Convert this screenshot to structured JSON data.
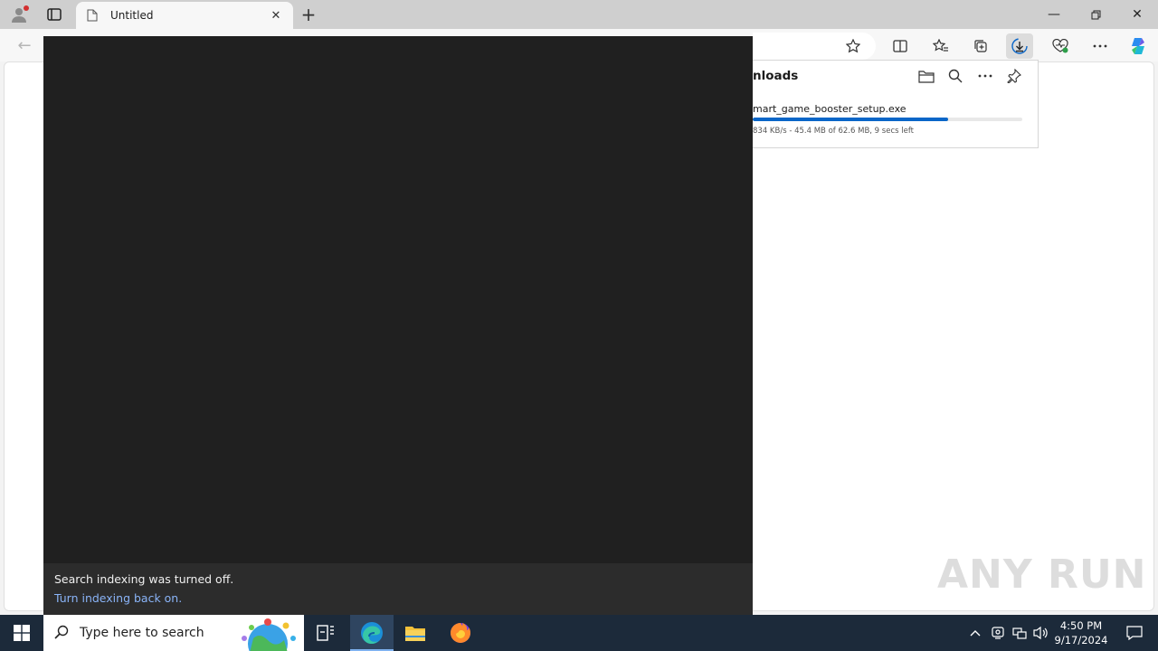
{
  "browser": {
    "tab": {
      "title": "Untitled"
    },
    "new_tab_label": "+"
  },
  "downloads": {
    "title": "nloads",
    "file_name": "mart_game_booster_setup.exe",
    "status": "834 KB/s - 45.4 MB of 62.6 MB, 9 secs left",
    "progress_fraction": 0.725
  },
  "search_panel": {
    "notice": "Search indexing was turned off.",
    "link": "Turn indexing back on."
  },
  "watermark": {
    "text": "ANY RUN"
  },
  "taskbar": {
    "search_placeholder": "Type here to search",
    "time": "4:50 PM",
    "date": "9/17/2024"
  },
  "colors": {
    "accent": "#0a66c8",
    "panel_bg": "#202020",
    "notice_bg": "#2c2c2c",
    "link": "#8ab4f8",
    "taskbar": "#1c2a3a"
  },
  "icons": [
    "profile-icon",
    "tab-actions-icon",
    "page-icon",
    "close-icon",
    "minimize-icon",
    "restore-icon",
    "back-icon",
    "favorite-star-icon",
    "split-screen-icon",
    "favorites-icon",
    "collections-icon",
    "downloads-icon",
    "browser-essentials-icon",
    "more-icon",
    "copilot-icon",
    "folder-icon",
    "search-icon",
    "pin-icon",
    "windows-start-icon",
    "task-view-icon",
    "edge-icon",
    "file-explorer-icon",
    "firefox-icon",
    "chevron-up-icon",
    "meet-now-icon",
    "network-icon",
    "volume-icon",
    "notification-icon"
  ]
}
